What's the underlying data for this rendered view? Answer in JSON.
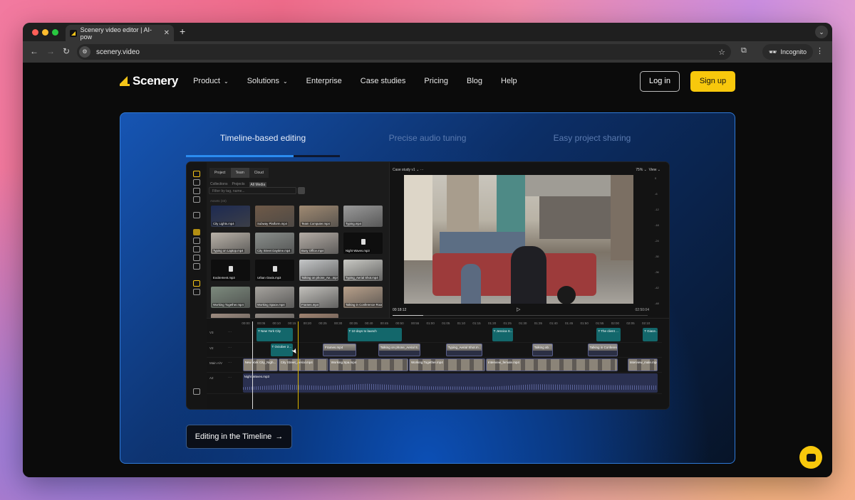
{
  "browser": {
    "tab_title": "Scenery video editor | AI-pow",
    "url": "scenery.video",
    "incognito_label": "Incognito"
  },
  "nav": {
    "brand": "Scenery",
    "links": [
      {
        "label": "Product",
        "dropdown": true
      },
      {
        "label": "Solutions",
        "dropdown": true
      },
      {
        "label": "Enterprise"
      },
      {
        "label": "Case studies"
      },
      {
        "label": "Pricing"
      },
      {
        "label": "Blog"
      },
      {
        "label": "Help"
      }
    ],
    "login": "Log in",
    "signup": "Sign up",
    "accent": "#f8c80c"
  },
  "hero": {
    "tabs": [
      "Timeline-based editing",
      "Precise audio tuning",
      "Easy project sharing"
    ],
    "active_tab": 0,
    "tab_progress": 0.7,
    "cta": "Editing in the Timeline",
    "cta_icon": "arrow-right-icon"
  },
  "editor": {
    "media_tabs": [
      "Project",
      "Team",
      "Cloud"
    ],
    "media_subtabs": [
      "Collections",
      "Projects",
      "All Media"
    ],
    "filter_placeholder": "Filter by tag, name...",
    "assets_label": "Assets (33)",
    "assets": [
      {
        "name": "City Lights.mp4",
        "type": "video",
        "color": "#1d2a52"
      },
      {
        "name": "Subway Platform.mp4",
        "type": "video",
        "color": "#6f5a48"
      },
      {
        "name": "Team Computer.mp4",
        "type": "video",
        "color": "#a08a72"
      },
      {
        "name": "Typing.mp4",
        "type": "video",
        "color": "#9a9a9a"
      },
      {
        "name": "Typing on Laptop.mp4",
        "type": "video",
        "color": "#b9b2a8"
      },
      {
        "name": "City Street Daytime.mp4",
        "type": "video",
        "color": "#8a8f8c"
      },
      {
        "name": "Busy Office.mp4",
        "type": "video",
        "color": "#b4aca5"
      },
      {
        "name": "Night Waves.mp3",
        "type": "audio"
      },
      {
        "name": "Excitement.mp3",
        "type": "audio"
      },
      {
        "name": "Urban Oasis.mp3",
        "type": "audio"
      },
      {
        "name": "Talking on phone_Ae...mp4",
        "type": "video",
        "color": "#c5c7c8"
      },
      {
        "name": "Typing_Aerial Shot.mp4",
        "type": "video",
        "color": "#c9c9c4"
      },
      {
        "name": "Working Together.mp4",
        "type": "video",
        "color": "#7c8a7d"
      },
      {
        "name": "Working Space.mp4",
        "type": "video",
        "color": "#a6a39e"
      },
      {
        "name": "Frames.mp4",
        "type": "video",
        "color": "#c2c0bb"
      },
      {
        "name": "Talking in Conference Room.mp4",
        "type": "video",
        "color": "#b8a08a"
      },
      {
        "name": "",
        "type": "video",
        "color": "#9e8c80"
      },
      {
        "name": "",
        "type": "video",
        "color": "#8e8680"
      },
      {
        "name": "",
        "type": "video",
        "color": "#a08370"
      }
    ],
    "preview": {
      "title": "Case study v1",
      "zoom": "75%",
      "view": "View",
      "current_time": "00:18:12",
      "duration": "02:50:04",
      "meter_ticks": [
        "0",
        "-6",
        "-12",
        "-18",
        "-24",
        "-30",
        "-36",
        "-42",
        "-48"
      ],
      "progress": 0.12
    },
    "timeline": {
      "ruler": [
        "00:00",
        "00:05",
        "00:10",
        "00:15",
        "00:20",
        "00:25",
        "00:30",
        "00:35",
        "00:40",
        "00:45",
        "00:50",
        "00:55",
        "01:00",
        "01:05",
        "01:10",
        "01:15",
        "01:20",
        "01:25",
        "01:30",
        "01:35",
        "01:40",
        "01:45",
        "01:50",
        "01:55",
        "02:00",
        "02:05",
        "02:10"
      ],
      "playhead_sec": 2,
      "marker_sec": 17,
      "tracks": [
        {
          "name": "V3",
          "kind": "t",
          "clips": [
            {
              "label": "T New York City",
              "start": 3.5,
              "end": 15.5
            },
            {
              "label": "T 10 days to launch",
              "start": 33,
              "end": 51
            },
            {
              "label": "T Jessica S...",
              "start": 80,
              "end": 87
            },
            {
              "label": "T The client ...",
              "start": 114,
              "end": 122
            },
            {
              "label": "T Giace...",
              "start": 129,
              "end": 134
            }
          ]
        },
        {
          "name": "V2",
          "kind": "v",
          "clips": [
            {
              "label": "T October 2...",
              "start": 8,
              "end": 15.5,
              "text": true
            },
            {
              "label": "Frames.mp4",
              "start": 25,
              "end": 36
            },
            {
              "label": "Talking on phone_Aerial S...",
              "start": 43,
              "end": 57
            },
            {
              "label": "Typing_Aerial Shot.m...",
              "start": 65,
              "end": 77
            },
            {
              "label": "Talking ab...",
              "start": 93,
              "end": 100
            },
            {
              "label": "Talking in Conference Room fr...",
              "start": 111,
              "end": 121
            }
          ]
        },
        {
          "name": "Main A/V",
          "kind": "m",
          "clips": [
            {
              "label": "New York City_Nigh...",
              "start": -1,
              "end": 10.6
            },
            {
              "label": "City Street_Aerial.mp4",
              "start": 10.6,
              "end": 27
            },
            {
              "label": "Working Spa.mp4",
              "start": 27,
              "end": 53
            },
            {
              "label": "Working Together.mp4",
              "start": 53,
              "end": 78
            },
            {
              "label": "Interview_female.mp4",
              "start": 78,
              "end": 121
            },
            {
              "label": "Interview_male.mp4",
              "start": 124,
              "end": 134
            }
          ]
        },
        {
          "name": "A2",
          "kind": "a",
          "clips": [
            {
              "label": "Night Waves.mp3",
              "start": -1,
              "end": 134
            }
          ]
        }
      ]
    }
  }
}
